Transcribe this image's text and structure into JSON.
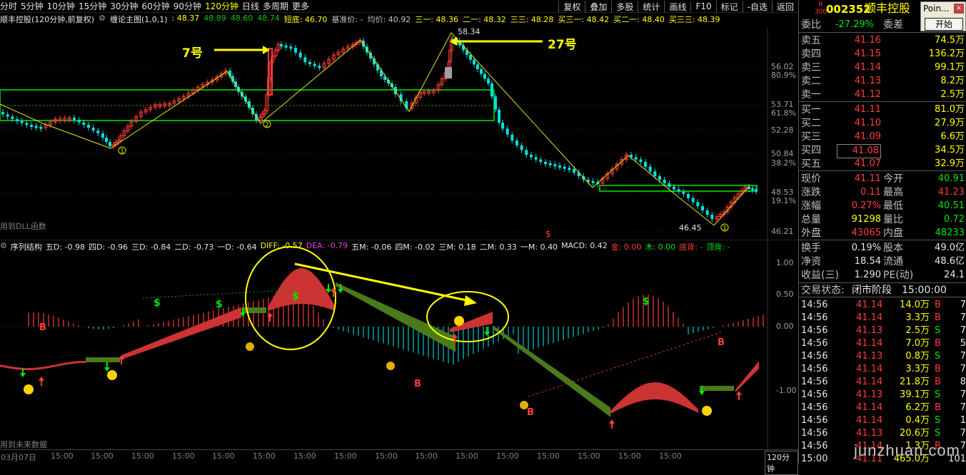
{
  "top_bar": {
    "periods": [
      "分时",
      "5分钟",
      "10分钟",
      "15分钟",
      "30分钟",
      "60分钟",
      "90分钟",
      "120分钟",
      "日线",
      "多周期",
      "更多"
    ],
    "active_period": "120分钟",
    "tools": [
      "复权",
      "叠加",
      "多股",
      "统计",
      "画线",
      "F10",
      "标记",
      "-自选",
      "返回"
    ]
  },
  "main": {
    "title": "顺丰控股(120分钟,前复权)",
    "indicator": "缠论主图(1,0,1)",
    "info": [
      {
        "text": ": 48.37",
        "color": "#ffff00"
      },
      {
        "text": "48.89",
        "color": "#00c800"
      },
      {
        "text": "48.60",
        "color": "#00c800"
      },
      {
        "text": "48.74",
        "color": "#00c800"
      },
      {
        "text": "短底: 46.70",
        "color": "#ffff00"
      },
      {
        "text": "基准价: -",
        "color": "#c0c0c0"
      },
      {
        "text": "均价: 40.92",
        "color": "#c0c0c0"
      },
      {
        "text": "三一: 48.36",
        "color": "#ffff00"
      },
      {
        "text": "二一: 48.32",
        "color": "#ffff00"
      },
      {
        "text": "三三: 48.28",
        "color": "#ffff00"
      },
      {
        "text": "买三一: 48.42",
        "color": "#ffff00"
      },
      {
        "text": "买二一: 48.40",
        "color": "#ffff00"
      },
      {
        "text": "买三三: 48.39",
        "color": "#ffff00"
      }
    ],
    "price_ticks": [
      {
        "v": "56.02",
        "c": "#a0a0a0"
      },
      {
        "v": "80.9%",
        "c": "#a0a0a0"
      },
      {
        "v": "53.71",
        "c": "#a0a0a0"
      },
      {
        "v": "61.8%",
        "c": "#a0a0a0"
      },
      {
        "v": "52.28",
        "c": "#a0a0a0"
      },
      {
        "v": "50.84",
        "c": "#a0a0a0"
      },
      {
        "v": "38.2%",
        "c": "#a0a0a0"
      },
      {
        "v": "48.53",
        "c": "#a0a0a0"
      },
      {
        "v": "19.1%",
        "c": "#a0a0a0"
      },
      {
        "v": "46.21",
        "c": "#a0a0a0"
      }
    ],
    "annotations": {
      "n7": "7号",
      "n27": "27号",
      "high": "58.34",
      "low": "46.45",
      "dll": "用到DLL函数",
      "s_mark": "$"
    },
    "circled": [
      "1",
      "2",
      "1"
    ]
  },
  "sub": {
    "title": "序列结构",
    "info": [
      {
        "text": "五D: -0.98",
        "color": "#e6e6e6"
      },
      {
        "text": "四D: -0.96",
        "color": "#e6e6e6"
      },
      {
        "text": "三D: -0.84",
        "color": "#e6e6e6"
      },
      {
        "text": "二D: -0.73",
        "color": "#e6e6e6"
      },
      {
        "text": "一D: -0.64",
        "color": "#e6e6e6"
      },
      {
        "text": "DIFF: -0.57",
        "color": "#ffff00"
      },
      {
        "text": "DEA: -0.79",
        "color": "#e040e0"
      },
      {
        "text": "五M: -0.06",
        "color": "#e6e6e6"
      },
      {
        "text": "四M: -0.02",
        "color": "#e6e6e6"
      },
      {
        "text": "三M: 0.18",
        "color": "#e6e6e6"
      },
      {
        "text": "二M: 0.33",
        "color": "#e6e6e6"
      },
      {
        "text": "一M: 0.40",
        "color": "#e6e6e6"
      },
      {
        "text": "MACD: 0.42",
        "color": "#e6e6e6"
      },
      {
        "text": "金: 0.00",
        "color": "#ff3c3c"
      },
      {
        "text": "木: 0.00",
        "color": "#00e600"
      },
      {
        "text": "底背: -",
        "color": "#ff3c3c"
      },
      {
        "text": "顶背: -",
        "color": "#00e600"
      }
    ],
    "ticks": [
      "1.00",
      "0.50",
      "0.00",
      "-1.00"
    ],
    "future": "用到未来数据"
  },
  "time_axis": {
    "labels": [
      "03月07日",
      "15:00",
      "15:00",
      "15:00",
      "15:00",
      "15:00",
      "15:00",
      "15:00",
      "15:00",
      "15:00",
      "15:00",
      "15:00",
      "15:00",
      "15:00",
      "15:00",
      "15:00",
      "15:00"
    ],
    "period_label": "120分钟"
  },
  "panel": {
    "code": "002352",
    "name": "顺丰控股",
    "r_badge": "R",
    "r_sub": "300",
    "weibi_label": "委比",
    "weibi": "-27.29%",
    "weicha_label": "委差",
    "asks": [
      {
        "label": "卖五",
        "price": "41.16",
        "vol": "74.5万"
      },
      {
        "label": "卖四",
        "price": "41.15",
        "vol": "136.2万"
      },
      {
        "label": "卖三",
        "price": "41.14",
        "vol": "99.1万"
      },
      {
        "label": "卖二",
        "price": "41.13",
        "vol": "8.2万"
      },
      {
        "label": "卖一",
        "price": "41.12",
        "vol": "2.5万"
      }
    ],
    "bids": [
      {
        "label": "买一",
        "price": "41.11",
        "vol": "81.0万"
      },
      {
        "label": "买二",
        "price": "41.10",
        "vol": "27.9万"
      },
      {
        "label": "买三",
        "price": "41.09",
        "vol": "6.6万"
      },
      {
        "label": "买四",
        "price": "41.08",
        "vol": "34.5万"
      },
      {
        "label": "买五",
        "price": "41.07",
        "vol": "32.9万"
      }
    ],
    "quote": [
      {
        "l1": "现价",
        "v1": "41.11",
        "c1": "#ff3c3c",
        "l2": "今开",
        "v2": "40.91",
        "c2": "#00e600"
      },
      {
        "l1": "涨跌",
        "v1": "0.11",
        "c1": "#ff3c3c",
        "l2": "最高",
        "v2": "41.23",
        "c2": "#ff3c3c"
      },
      {
        "l1": "涨幅",
        "v1": "0.27%",
        "c1": "#ff3c3c",
        "l2": "最低",
        "v2": "40.51",
        "c2": "#00e600"
      },
      {
        "l1": "总量",
        "v1": "91298",
        "c1": "#ffff00",
        "l2": "量比",
        "v2": "0.72",
        "c2": "#00e600"
      },
      {
        "l1": "外盘",
        "v1": "43065",
        "c1": "#ff3c3c",
        "l2": "内盘",
        "v2": "48233",
        "c2": "#00e600"
      }
    ],
    "fund": [
      {
        "l1": "换手",
        "v1": "0.19%",
        "l2": "股本",
        "v2": "49.0亿"
      },
      {
        "l1": "净资",
        "v1": "18.54",
        "l2": "流通",
        "v2": "48.6亿"
      },
      {
        "l1": "收益(三)",
        "v1": "1.290",
        "l2": "PE(动)",
        "v2": "24.1"
      }
    ],
    "status_label": "交易状态:",
    "status": "闭市阶段",
    "status_time": "15:00:00",
    "ticks": [
      {
        "t": "14:56",
        "p": "41.14",
        "v": "14.0万",
        "d": "B",
        "n": "7"
      },
      {
        "t": "14:56",
        "p": "41.14",
        "v": "3.3万",
        "d": "B",
        "n": "7"
      },
      {
        "t": "14:56",
        "p": "41.13",
        "v": "2.5万",
        "d": "S",
        "n": "7"
      },
      {
        "t": "14:56",
        "p": "41.14",
        "v": "7.0万",
        "d": "B",
        "n": "5"
      },
      {
        "t": "14:56",
        "p": "41.13",
        "v": "0.8万",
        "d": "S",
        "n": "7"
      },
      {
        "t": "14:56",
        "p": "41.14",
        "v": "3.3万",
        "d": "B",
        "n": "7"
      },
      {
        "t": "14:56",
        "p": "41.14",
        "v": "21.8万",
        "d": "B",
        "n": "8"
      },
      {
        "t": "14:56",
        "p": "41.13",
        "v": "39.1万",
        "d": "S",
        "n": "7"
      },
      {
        "t": "14:56",
        "p": "41.14",
        "v": "6.2万",
        "d": "B",
        "n": "7"
      },
      {
        "t": "14:56",
        "p": "41.14",
        "v": "0.4万",
        "d": "S",
        "n": "1"
      },
      {
        "t": "14:56",
        "p": "41.13",
        "v": "20.6万",
        "d": "S",
        "n": "7"
      },
      {
        "t": "14:56",
        "p": "41.14",
        "v": "1.3万",
        "d": "B",
        "n": "7"
      },
      {
        "t": "15:00",
        "p": "41.11",
        "v": "465.0万",
        "d": "",
        "n": "101"
      }
    ]
  },
  "popup": {
    "title": "Poin...",
    "close": "×",
    "button": "开始"
  },
  "watermark": "junzhuan.com"
}
